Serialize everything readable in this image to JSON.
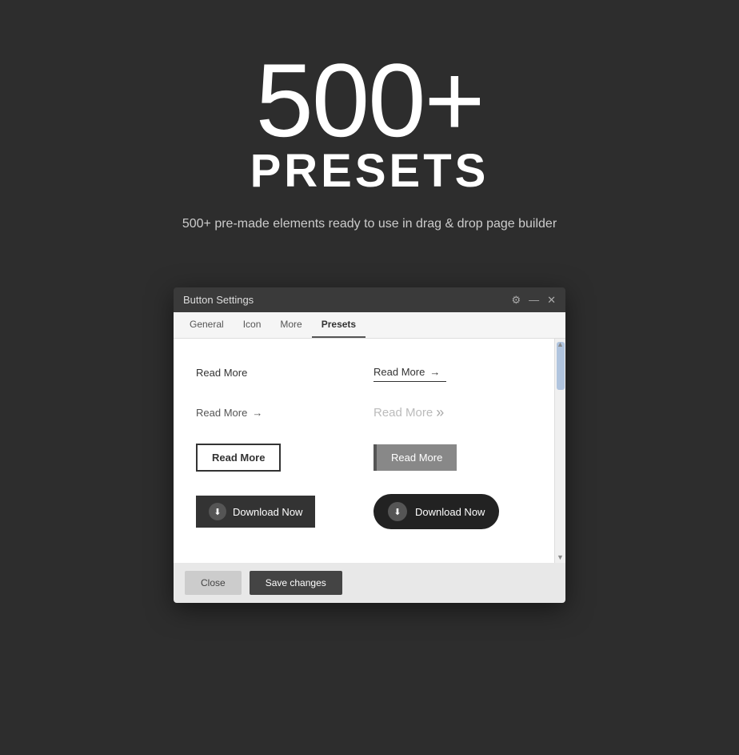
{
  "hero": {
    "number": "500+",
    "title": "PRESETS",
    "subtitle": "500+ pre-made elements ready to use in drag & drop page builder"
  },
  "dialog": {
    "title": "Button Settings",
    "tabs": [
      "General",
      "Icon",
      "More",
      "Presets"
    ],
    "active_tab": "Presets",
    "controls": {
      "settings": "⚙",
      "minimize": "—",
      "close": "✕"
    },
    "presets": [
      {
        "id": "plain-1",
        "label": "Read More",
        "type": "plain"
      },
      {
        "id": "underline-arrow",
        "label": "Read More →",
        "type": "underline-arrow"
      },
      {
        "id": "plain-arrow",
        "label": "Read More →",
        "type": "plain-arrow"
      },
      {
        "id": "double-arrow",
        "label": "Read More »",
        "type": "double-arrow"
      },
      {
        "id": "outline",
        "label": "Read More",
        "type": "outline"
      },
      {
        "id": "gray-block",
        "label": "Read More",
        "type": "gray-block"
      },
      {
        "id": "black-icon-1",
        "label": "Download Now",
        "type": "black-icon"
      },
      {
        "id": "black-round-icon",
        "label": "Download Now",
        "type": "black-round-icon"
      }
    ],
    "footer": {
      "close_label": "Close",
      "save_label": "Save changes"
    }
  }
}
